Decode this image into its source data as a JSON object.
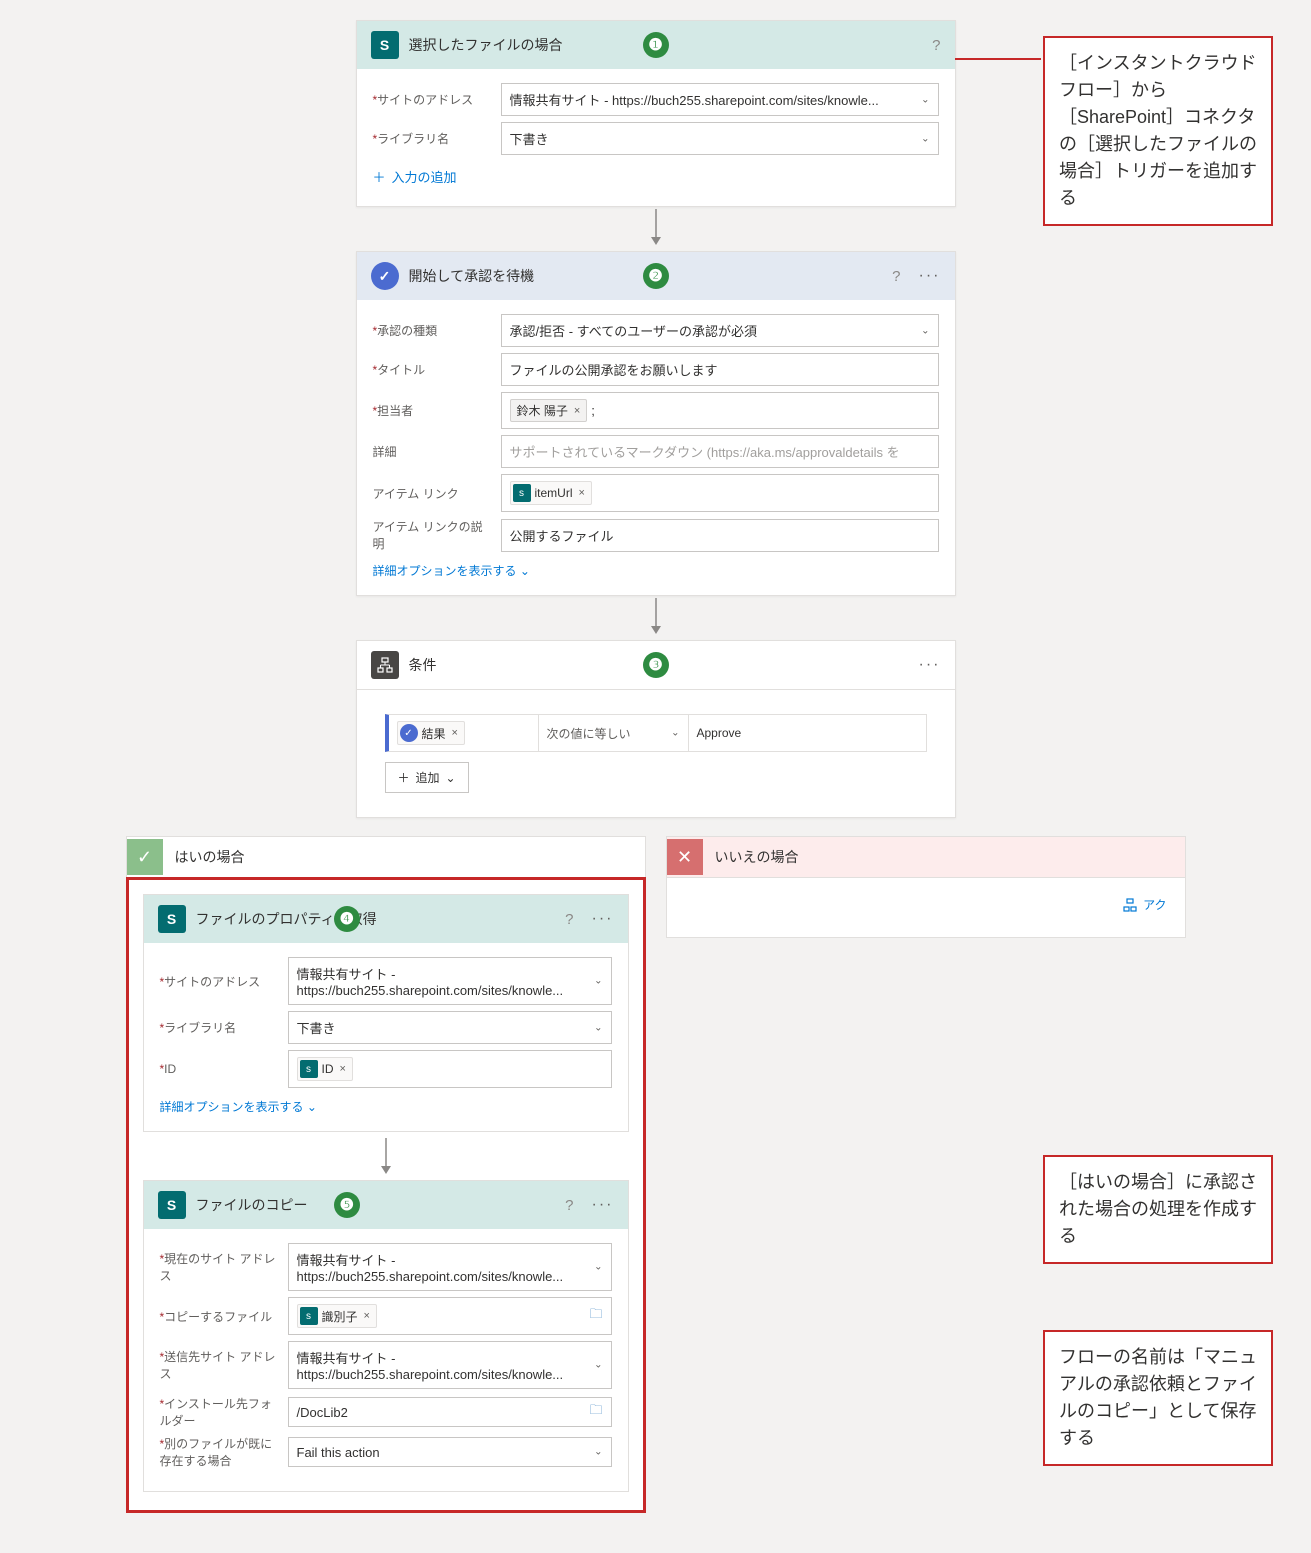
{
  "step1": {
    "title": "選択したファイルの場合",
    "fields": {
      "site_label": "サイトのアドレス",
      "site_value": "情報共有サイト - https://buch255.sharepoint.com/sites/knowle...",
      "lib_label": "ライブラリ名",
      "lib_value": "下書き",
      "add_input": "入力の追加"
    }
  },
  "step2": {
    "title": "開始して承認を待機",
    "fields": {
      "type_label": "承認の種類",
      "type_value": "承認/拒否 - すべてのユーザーの承認が必須",
      "title_label": "タイトル",
      "title_value": "ファイルの公開承認をお願いします",
      "assignee_label": "担当者",
      "assignee_token": "鈴木 陽子",
      "details_label": "詳細",
      "details_placeholder": "サポートされているマークダウン (https://aka.ms/approvaldetails を",
      "itemlink_label": "アイテム リンク",
      "itemlink_token": "itemUrl",
      "itemlinkdesc_label": "アイテム リンクの説明",
      "itemlinkdesc_value": "公開するファイル",
      "adv": "詳細オプションを表示する"
    }
  },
  "step3": {
    "title": "条件",
    "cond": {
      "left_token": "結果",
      "op": "次の値に等しい",
      "right": "Approve",
      "add": "追加"
    }
  },
  "branches": {
    "yes_title": "はいの場合",
    "no_title": "いいえの場合",
    "no_action": "アク"
  },
  "step4": {
    "title": "ファイルのプロパティの取得",
    "fields": {
      "site_label": "サイトのアドレス",
      "site_value": "情報共有サイト - https://buch255.sharepoint.com/sites/knowle...",
      "lib_label": "ライブラリ名",
      "lib_value": "下書き",
      "id_label": "ID",
      "id_token": "ID",
      "adv": "詳細オプションを表示する"
    }
  },
  "step5": {
    "title": "ファイルのコピー",
    "fields": {
      "cursite_label": "現在のサイト アドレス",
      "cursite_value": "情報共有サイト - https://buch255.sharepoint.com/sites/knowle...",
      "file_label": "コピーするファイル",
      "file_token": "識別子",
      "dest_label": "送信先サイト アドレス",
      "dest_value": "情報共有サイト - https://buch255.sharepoint.com/sites/knowle...",
      "folder_label": "インストール先フォルダー",
      "folder_value": "/DocLib2",
      "exists_label": "別のファイルが既に存在する場合",
      "exists_value": "Fail this action"
    }
  },
  "annotations": {
    "a1": "［インスタントクラウドフロー］から［SharePoint］コネクタの［選択したファイルの場合］トリガーを追加する",
    "a2": "［はいの場合］に承認された場合の処理を作成する",
    "a3": "フローの名前は「マニュアルの承認依頼とファイルのコピー」として保存する"
  },
  "icons": {
    "help": "?",
    "more": "···",
    "close": "×",
    "plus": "＋",
    "chev_down": "⌄"
  }
}
